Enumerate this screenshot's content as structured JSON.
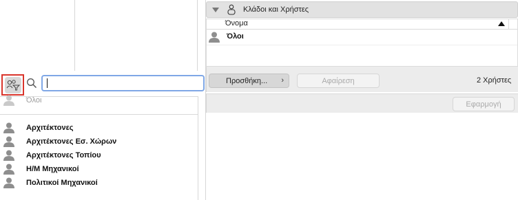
{
  "search": {
    "value": "",
    "placeholder": ""
  },
  "list": {
    "all_label": "Όλοι",
    "items": [
      {
        "label": "Αρχιτέκτονες"
      },
      {
        "label": "Αρχιτέκτονες Εσ. Χώρων"
      },
      {
        "label": "Αρχιτέκτονες Τοπίου"
      },
      {
        "label": "Η/Μ Μηχανικοί"
      },
      {
        "label": "Πολιτικοί Μηχανικοί"
      }
    ]
  },
  "group": {
    "title": "Κλάδοι και Χρήστες"
  },
  "table": {
    "column_name": "Όνομα",
    "sort": "ascending",
    "rows": [
      {
        "name": "Όλοι"
      }
    ]
  },
  "toolbar": {
    "add_label": "Προσθήκη...",
    "add_chevron": "›",
    "remove_label": "Αφαίρεση",
    "count_label": "2 Χρήστες"
  },
  "apply": {
    "label": "Εφαρμογή"
  },
  "colors": {
    "highlight": "#d9342b",
    "focus_ring": "#7fa7e6"
  }
}
